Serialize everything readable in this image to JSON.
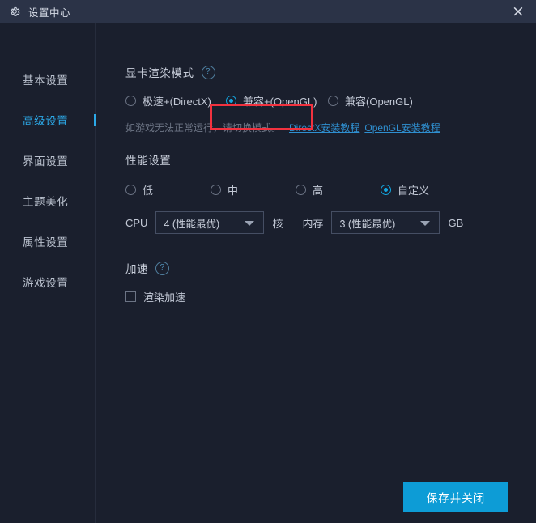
{
  "window": {
    "title": "设置中心",
    "gear_icon": "gear-icon",
    "close_icon": "×"
  },
  "sidebar": {
    "items": [
      {
        "label": "基本设置",
        "active": false
      },
      {
        "label": "高级设置",
        "active": true
      },
      {
        "label": "界面设置",
        "active": false
      },
      {
        "label": "主题美化",
        "active": false
      },
      {
        "label": "属性设置",
        "active": false
      },
      {
        "label": "游戏设置",
        "active": false
      }
    ]
  },
  "render_mode": {
    "title": "显卡渲染模式",
    "help_icon": "?",
    "options": [
      {
        "label": "极速+(DirectX)",
        "selected": false
      },
      {
        "label": "兼容+(OpenGL)",
        "selected": true
      },
      {
        "label": "兼容(OpenGL)",
        "selected": false
      }
    ],
    "highlight_color": "#f2323f",
    "hint": "如游戏无法正常运行，请切换模式。",
    "links": [
      {
        "label": "DirectX安装教程"
      },
      {
        "label": "OpenGL安装教程"
      }
    ]
  },
  "performance": {
    "title": "性能设置",
    "options": [
      {
        "label": "低",
        "selected": false
      },
      {
        "label": "中",
        "selected": false
      },
      {
        "label": "高",
        "selected": false
      },
      {
        "label": "自定义",
        "selected": true
      }
    ],
    "cpu": {
      "label": "CPU",
      "value": "4 (性能最优)",
      "unit": "核"
    },
    "memory": {
      "label": "内存",
      "value": "3 (性能最优)",
      "unit": "GB"
    }
  },
  "acceleration": {
    "title": "加速",
    "help_icon": "?",
    "checkbox": {
      "label": "渲染加速",
      "checked": false
    }
  },
  "footer": {
    "save_label": "保存并关闭",
    "accent_color": "#0d9cd6"
  }
}
